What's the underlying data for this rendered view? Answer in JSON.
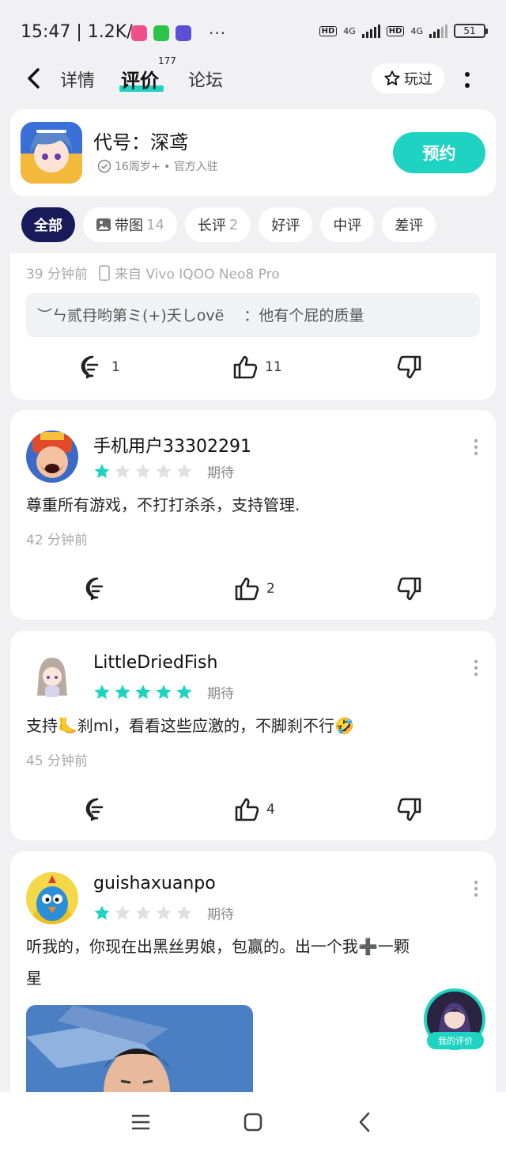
{
  "status": {
    "time": "15:47",
    "speed": "1.2K/s",
    "dots": "···",
    "hd1": "HD",
    "net1": "4G",
    "hd2": "HD",
    "net2": "4G",
    "battery": "51"
  },
  "nav": {
    "tab_detail": "详情",
    "tab_review": "评价",
    "review_count": "177",
    "tab_forum": "论坛",
    "played_label": "玩过"
  },
  "game": {
    "title": "代号：深鸢",
    "subtitle": "16周岁+ • 官方入驻",
    "reserve_label": "预约"
  },
  "filters": [
    {
      "label": "全部",
      "count": ""
    },
    {
      "label": "带图",
      "count": "14"
    },
    {
      "label": "长评",
      "count": "2"
    },
    {
      "label": "好评",
      "count": ""
    },
    {
      "label": "中评",
      "count": ""
    },
    {
      "label": "差评",
      "count": ""
    }
  ],
  "reviews": [
    {
      "time": "39 分钟前",
      "device": "来自 Vivo IQOO Neo8 Pro",
      "reply_text": "︶ㄣ贰冄哟第ミ(+)夭しovë　 ：他有个屁的质量",
      "comments": "1",
      "likes": "11"
    },
    {
      "username": "手机用户33302291",
      "rating": 1,
      "expect": "期待",
      "text": "尊重所有游戏，不打打杀杀，支持管理.",
      "time": "42 分钟前",
      "comments": "",
      "likes": "2"
    },
    {
      "username": "LittleDriedFish",
      "rating": 5,
      "expect": "期待",
      "text": "支持🦶刹ml，看看这些应激的，不脚刹不行🤣",
      "time": "45 分钟前",
      "comments": "",
      "likes": "4"
    },
    {
      "username": "guishaxuanpo",
      "rating": 1,
      "expect": "期待",
      "text_line1": "听我的，你现在出黑丝男娘，包赢的。出一个我➕一颗",
      "text_line2": "星"
    }
  ],
  "my_review_label": "我的评价",
  "colors": {
    "accent": "#1fd3c2",
    "active_chip": "#1a1a5a",
    "star_on": "#1fd3c2",
    "star_off": "#e0e0e0"
  }
}
